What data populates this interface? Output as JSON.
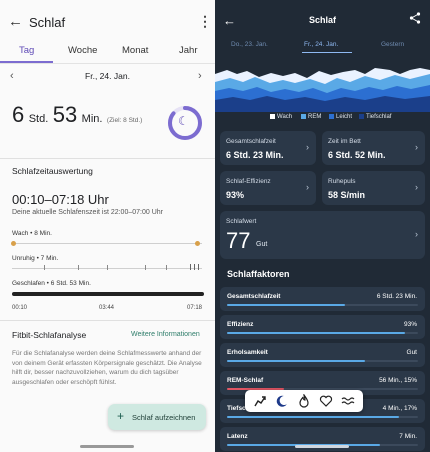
{
  "left": {
    "title": "Schlaf",
    "tabs": [
      {
        "label": "Tag"
      },
      {
        "label": "Woche"
      },
      {
        "label": "Monat"
      },
      {
        "label": "Jahr"
      }
    ],
    "date": "Fr., 24. Jan.",
    "sleep": {
      "hours": "6",
      "hours_unit": "Std.",
      "minutes": "53",
      "minutes_unit": "Min.",
      "goal": "(Ziel: 8 Std.)"
    },
    "ring_progress": 0.86,
    "section_timing": "Schlafzeitauswertung",
    "time_range": "00:10–07:18 Uhr",
    "schedule_text": "Deine aktuelle Schlafenszeit ist 22:00–07:00 Uhr",
    "stages": {
      "wach": "Wach • 8 Min.",
      "unruhig": "Unruhig • 7 Min.",
      "geschlafen": "Geschlafen • 6 Std. 53 Min."
    },
    "time_ticks": [
      "00:10",
      "03:44",
      "07:18"
    ],
    "analysis_title": "Fitbit-Schlafanalyse",
    "analysis_link": "Weitere Informationen",
    "analysis_text": "Für die Schlafanalyse werden deine Schlafmesswerte anhand der von deinem Gerät erfassten Körpersignale geschätzt. Die Analyse hilft dir, besser nachzuvollziehen, warum du dich tagsüber ausgeschlafen oder erschöpft fühlst.",
    "fab_label": "Schlaf aufzeichnen",
    "colors": {
      "accent": "#7c6cd0",
      "wake": "#d8a04a",
      "fab_bg": "#cfe9e1"
    }
  },
  "right": {
    "title": "Schlaf",
    "dates": [
      "Do., 23. Jan.",
      "Fr., 24. Jan.",
      "Gestern"
    ],
    "legend": [
      {
        "label": "Wach",
        "color": "#ffffff"
      },
      {
        "label": "REM",
        "color": "#5aa9e6"
      },
      {
        "label": "Leicht",
        "color": "#2c6fd1"
      },
      {
        "label": "Tiefschlaf",
        "color": "#1b3f8a"
      }
    ],
    "cards": [
      {
        "label": "Gesamtschlafzeit",
        "value": "6 Std. 23 Min."
      },
      {
        "label": "Zeit im Bett",
        "value": "6 Std. 52 Min."
      },
      {
        "label": "Schlaf-Effizienz",
        "value": "93%"
      },
      {
        "label": "Ruhepuls",
        "value": "58 S/min"
      }
    ],
    "score": {
      "label": "Schlafwert",
      "value": "77",
      "rating": "Gut"
    },
    "factors_title": "Schlaffaktoren",
    "factors": [
      {
        "name": "Gesamtschlafzeit",
        "value": "6 Std. 23 Min.",
        "level": 0.62,
        "color": "#5aa9e6"
      },
      {
        "name": "Effizienz",
        "value": "93%",
        "level": 0.93,
        "color": "#5aa9e6"
      },
      {
        "name": "Erholsamkeit",
        "value": "Gut",
        "level": 0.72,
        "color": "#5aa9e6"
      },
      {
        "name": "REM-Schlaf",
        "value": "56 Min., 15%",
        "level": 0.3,
        "color": "#e05563"
      },
      {
        "name": "Tiefschlaf",
        "value": "4 Min., 17%",
        "level": 0.9,
        "color": "#5aa9e6"
      },
      {
        "name": "Latenz",
        "value": "7 Min.",
        "level": 0.8,
        "color": "#5aa9e6"
      }
    ],
    "toolbar_icons": [
      "steps-icon",
      "moon-icon",
      "flame-icon",
      "heart-icon",
      "waves-icon"
    ]
  }
}
